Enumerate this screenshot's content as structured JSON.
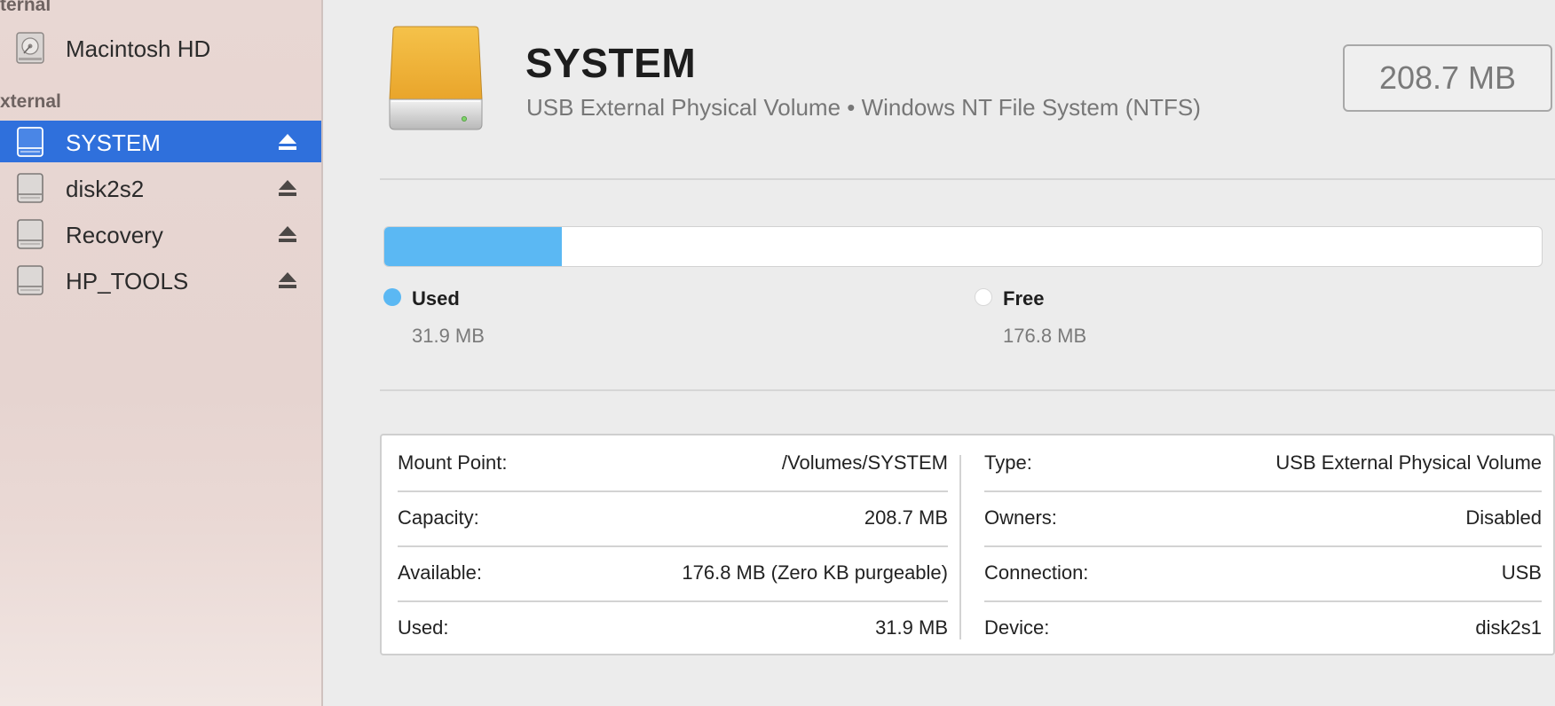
{
  "sidebar": {
    "internal_header": "ternal",
    "external_header": "xternal",
    "internal_items": [
      {
        "label": "Macintosh HD",
        "icon": "internal-disk-icon"
      }
    ],
    "external_items": [
      {
        "label": "SYSTEM",
        "icon": "external-disk-icon",
        "selected": true,
        "ejectable": true
      },
      {
        "label": "disk2s2",
        "icon": "external-disk-icon",
        "selected": false,
        "ejectable": true
      },
      {
        "label": "Recovery",
        "icon": "external-disk-icon",
        "selected": false,
        "ejectable": true
      },
      {
        "label": "HP_TOOLS",
        "icon": "external-disk-icon",
        "selected": false,
        "ejectable": true
      }
    ],
    "selection_color": "#2f70dc"
  },
  "volume": {
    "name": "SYSTEM",
    "subtitle": "USB External Physical Volume • Windows NT File System (NTFS)",
    "size": "208.7 MB",
    "icon": "orange-external-drive-icon"
  },
  "usage": {
    "used_fraction": 0.153,
    "used_color": "#5bb8f3",
    "free_color": "#ffffff",
    "used_label": "Used",
    "used_value": "31.9 MB",
    "free_label": "Free",
    "free_value": "176.8 MB"
  },
  "info": {
    "left": [
      {
        "label": "Mount Point:",
        "value": "/Volumes/SYSTEM"
      },
      {
        "label": "Capacity:",
        "value": "208.7 MB"
      },
      {
        "label": "Available:",
        "value": "176.8 MB (Zero KB purgeable)"
      },
      {
        "label": "Used:",
        "value": "31.9 MB"
      }
    ],
    "right": [
      {
        "label": "Type:",
        "value": "USB External Physical Volume"
      },
      {
        "label": "Owners:",
        "value": "Disabled"
      },
      {
        "label": "Connection:",
        "value": "USB"
      },
      {
        "label": "Device:",
        "value": "disk2s1"
      }
    ]
  }
}
